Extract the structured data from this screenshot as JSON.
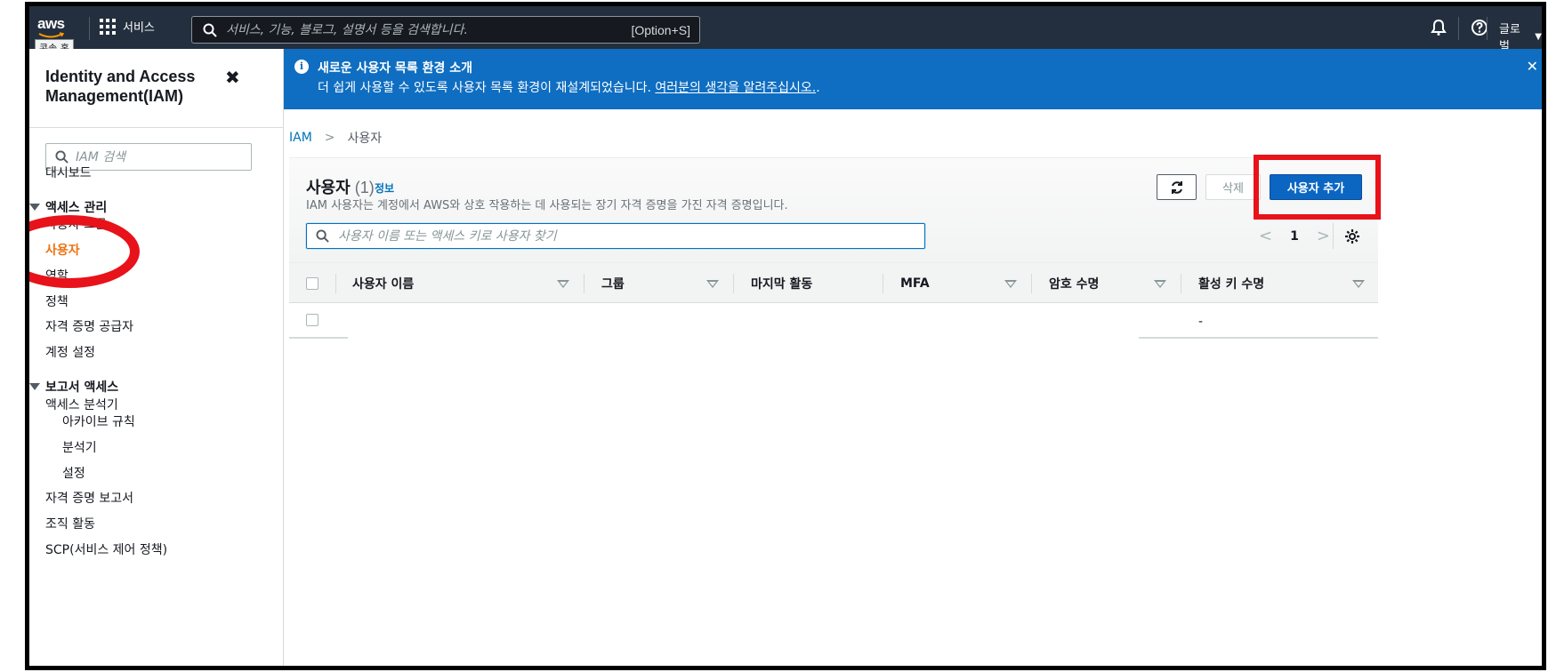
{
  "topnav": {
    "logo_text": "aws",
    "logo_tooltip": "콘솔 홈",
    "services_label": "서비스",
    "search_placeholder": "서비스, 기능, 블로그, 설명서 등을 검색합니다.",
    "search_shortcut": "[Option+S]",
    "region_label": "글로벌"
  },
  "sidebar": {
    "title": "Identity and Access Management(IAM)",
    "title_line1": "Identity and Access",
    "title_line2": "Management(IAM)",
    "search_placeholder": "IAM 검색",
    "dashboard": "대시보드",
    "access_management": {
      "label": "액세스 관리",
      "items": [
        "사용자 그룹",
        "사용자",
        "역할",
        "정책",
        "자격 증명 공급자",
        "계정 설정"
      ]
    },
    "access_reports": {
      "label": "보고서 액세스",
      "analyzer": "액세스 분석기",
      "sub_items": [
        "아카이브 규칙",
        "분석기",
        "설정"
      ],
      "items": [
        "자격 증명 보고서",
        "조직 활동",
        "SCP(서비스 제어 정책)"
      ]
    }
  },
  "banner": {
    "title": "새로운 사용자 목록 환경 소개",
    "text": "더 쉽게 사용할 수 있도록 사용자 목록 환경이 재설계되었습니다. ",
    "link": "여러분의 생각을 알려주십시오.",
    "suffix": "."
  },
  "breadcrumb": {
    "root": "IAM",
    "current": "사용자"
  },
  "panel": {
    "title": "사용자",
    "count": "(1)",
    "info": "정보",
    "description": "IAM 사용자는 계정에서 AWS와 상호 작용하는 데 사용되는 장기 자격 증명을 가진 자격 증명입니다.",
    "delete_label": "삭제",
    "add_label": "사용자 추가",
    "filter_placeholder": "사용자 이름 또는 액세스 키로 사용자 찾기",
    "page_number": "1"
  },
  "table": {
    "columns": [
      "사용자 이름",
      "그룹",
      "마지막 활동",
      "MFA",
      "암호 수명",
      "활성 키 수명"
    ],
    "rows": [
      {
        "username": "",
        "groups": "",
        "last_activity": "",
        "mfa": "",
        "password_age": "",
        "active_key_age": "-"
      }
    ]
  },
  "colors": {
    "nav_bg": "#232f3e",
    "banner_bg": "#0f6ec1",
    "primary_button": "#0b66c2",
    "active_nav": "#ec7211",
    "annotation_red": "#e8121a",
    "link": "#0073bb"
  },
  "icons": [
    "grid-icon",
    "search-icon",
    "bell-icon",
    "help-icon",
    "close-icon",
    "info-icon",
    "refresh-icon",
    "settings-icon",
    "sort-icon"
  ]
}
